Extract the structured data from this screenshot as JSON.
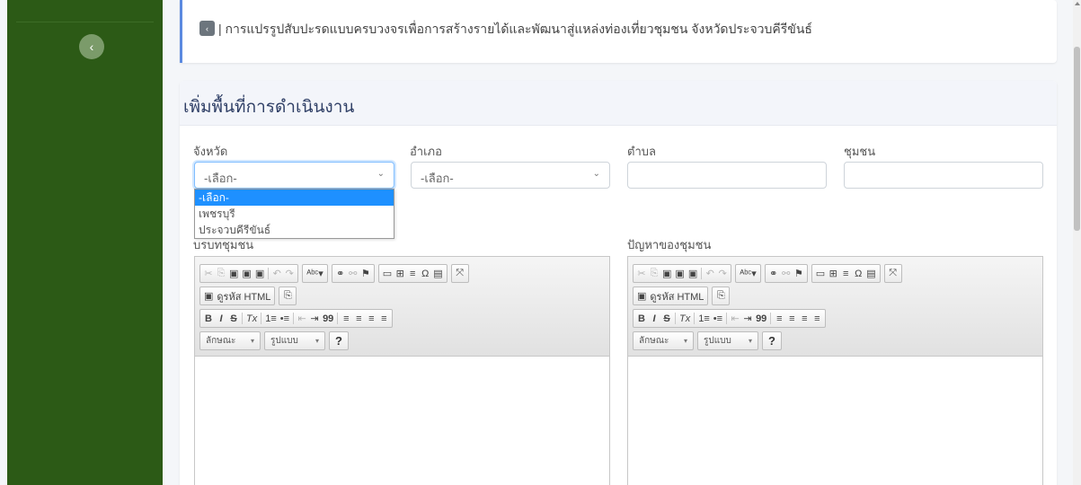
{
  "sidebar": {
    "toggle_icon": "chevron-left-icon",
    "toggle_glyph": "‹"
  },
  "breadcrumb": {
    "back_glyph": "‹",
    "text": "| การแปรรูปสับปะรดแบบครบวงจรเพื่อการสร้างรายได้และพัฒนาสู่แหล่งท่องเที่ยวชุมชน จังหวัดประจวบคีรีขันธ์"
  },
  "form": {
    "title": "เพิ่มพื้นที่การดำเนินงาน",
    "province": {
      "label": "จังหวัด",
      "value": "-เลือก-",
      "options": [
        "-เลือก-",
        "เพชรบุรี",
        "ประจวบคีรีขันธ์"
      ]
    },
    "district": {
      "label": "อำเภอ",
      "value": "-เลือก-"
    },
    "subdistrict": {
      "label": "ตำบล",
      "value": ""
    },
    "community": {
      "label": "ชุมชน",
      "value": ""
    },
    "editor_left": {
      "label": "บริบทชุมชน"
    },
    "editor_right": {
      "label": "ปัญหาของชุมชน"
    }
  },
  "editor_toolbar": {
    "source_label": "ดูรหัส HTML",
    "style_label": "ลักษณะ",
    "format_label": "รูปแบบ",
    "help_label": "?",
    "row1": [
      "✂",
      "⎘",
      "▣",
      "▣",
      "▣",
      "↶",
      "↷",
      "ᴬᵇᶜ▾",
      "⚭",
      "⚯",
      "⚑",
      "▭",
      "⊞",
      "≡",
      "Ω",
      "▤",
      "⤧"
    ],
    "row3": [
      "B",
      "I",
      "S",
      "Tx",
      "1≡",
      "•≡",
      "⇤",
      "⇥",
      "99",
      "≡",
      "≡",
      "≡",
      "≡"
    ]
  },
  "colors": {
    "sidebar": "#2c5a16",
    "accent": "#5b8ae0",
    "selected_option": "#1e90ff"
  }
}
